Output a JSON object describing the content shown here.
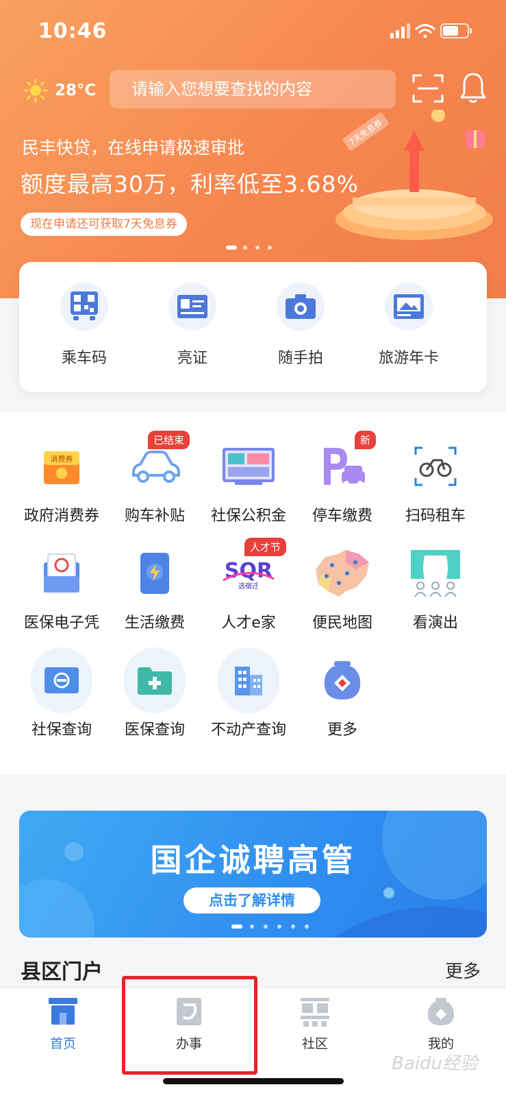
{
  "status": {
    "time": "10:46"
  },
  "header": {
    "weather": {
      "temp": "28°C"
    },
    "search_placeholder": "请输入您想要查找的内容"
  },
  "banner": {
    "line1": "民丰快贷，在线申请极速审批",
    "line2": "额度最高30万，利率低至3.68%",
    "pill": "现在申请还可获取7天免息券",
    "tag_text": "7天免息券"
  },
  "quick_actions": [
    {
      "label": "乘车码",
      "icon": "qr-code-bus-icon"
    },
    {
      "label": "亮证",
      "icon": "id-card-icon"
    },
    {
      "label": "随手拍",
      "icon": "camera-icon"
    },
    {
      "label": "旅游年卡",
      "icon": "picture-card-icon"
    }
  ],
  "services": [
    {
      "label": "政府消费券",
      "icon": "coupon-icon",
      "icon_text": "消费券"
    },
    {
      "label": "购车补贴",
      "icon": "car-icon",
      "badge": "已结束"
    },
    {
      "label": "社保公积金",
      "icon": "dashboard-screen-icon"
    },
    {
      "label": "停车缴费",
      "icon": "parking-icon",
      "badge": "新"
    },
    {
      "label": "扫码租车",
      "icon": "bicycle-icon"
    },
    {
      "label": "医保电子凭",
      "icon": "medical-card-icon"
    },
    {
      "label": "生活缴费",
      "icon": "phone-bolt-icon"
    },
    {
      "label": "人才e家",
      "icon": "talent-logo-icon",
      "badge": "人才节",
      "icon_text": "SQR",
      "icon_text2": "选宿迁"
    },
    {
      "label": "便民地图",
      "icon": "map-icon"
    },
    {
      "label": "看演出",
      "icon": "stage-icon"
    },
    {
      "label": "社保查询",
      "icon": "social-security-card-icon"
    },
    {
      "label": "医保查询",
      "icon": "folder-plus-icon"
    },
    {
      "label": "不动产查询",
      "icon": "building-icon"
    },
    {
      "label": "更多",
      "icon": "more-jar-icon"
    }
  ],
  "ad": {
    "title": "国企诚聘高管",
    "button": "点击了解详情"
  },
  "county": {
    "title": "县区门户",
    "more": "更多"
  },
  "tabs": [
    {
      "label": "首页",
      "icon": "home-icon",
      "active": true
    },
    {
      "label": "办事",
      "icon": "tasks-icon",
      "active": false
    },
    {
      "label": "社区",
      "icon": "community-icon",
      "active": false
    },
    {
      "label": "我的",
      "icon": "profile-icon",
      "active": false
    }
  ],
  "watermark": "Baidu经验",
  "colors": {
    "accent": "#f6864f",
    "blue": "#2f8ef0",
    "active_tab": "#3a7bdd",
    "badge": "#e8403a",
    "highlight": "#e5232b"
  }
}
